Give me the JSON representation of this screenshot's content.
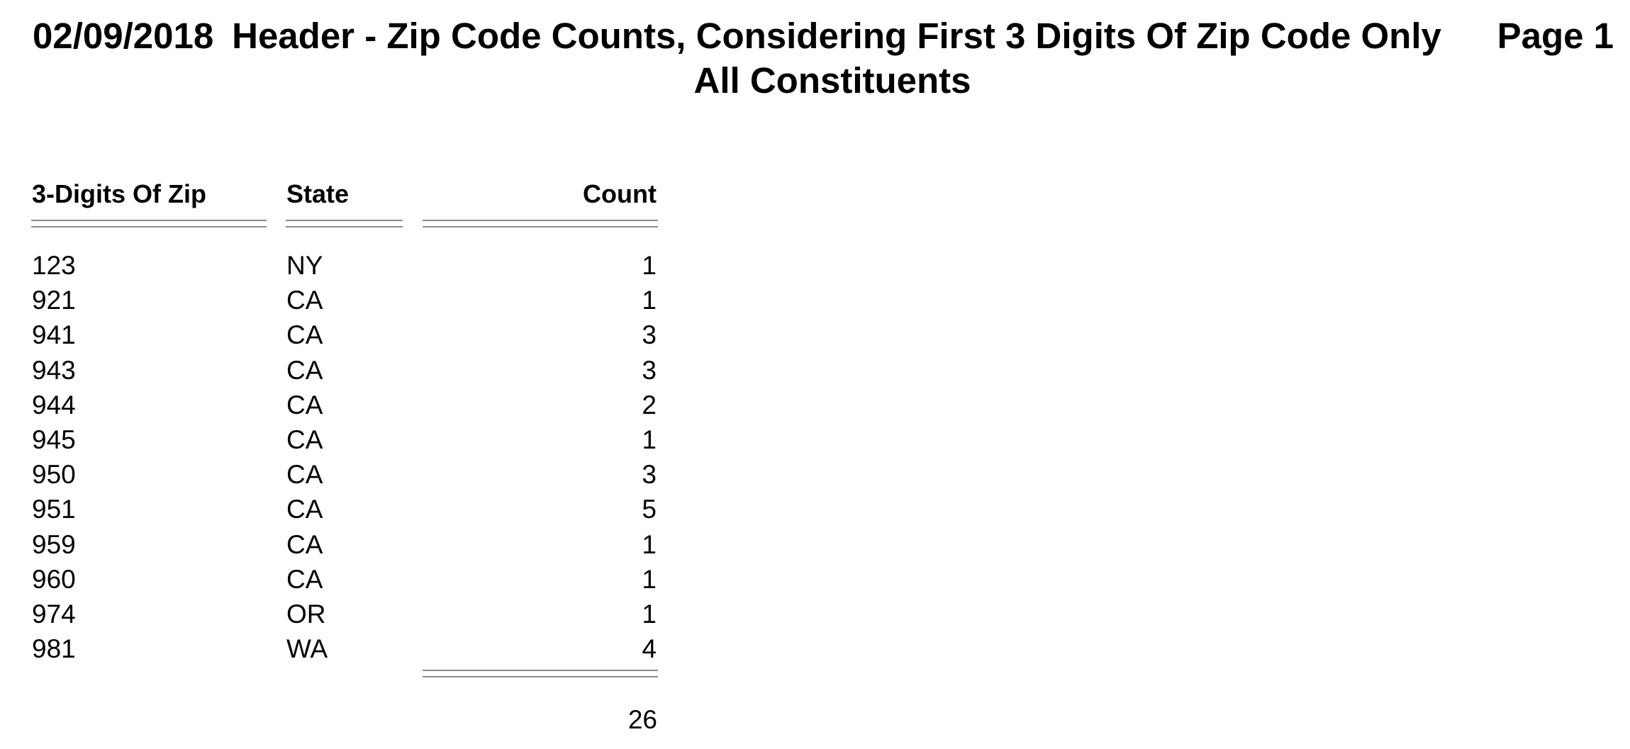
{
  "report": {
    "date": "02/09/2018",
    "title": "Header - Zip Code Counts, Considering First 3 Digits Of Zip Code Only",
    "page": "Page 1",
    "subtitle": "All Constituents"
  },
  "table": {
    "columns": [
      "3-Digits Of Zip",
      "State",
      "Count"
    ],
    "rows": [
      {
        "zip": "123",
        "state": "NY",
        "count": "1"
      },
      {
        "zip": "921",
        "state": "CA",
        "count": "1"
      },
      {
        "zip": "941",
        "state": "CA",
        "count": "3"
      },
      {
        "zip": "943",
        "state": "CA",
        "count": "3"
      },
      {
        "zip": "944",
        "state": "CA",
        "count": "2"
      },
      {
        "zip": "945",
        "state": "CA",
        "count": "1"
      },
      {
        "zip": "950",
        "state": "CA",
        "count": "3"
      },
      {
        "zip": "951",
        "state": "CA",
        "count": "5"
      },
      {
        "zip": "959",
        "state": "CA",
        "count": "1"
      },
      {
        "zip": "960",
        "state": "CA",
        "count": "1"
      },
      {
        "zip": "974",
        "state": "OR",
        "count": "1"
      },
      {
        "zip": "981",
        "state": "WA",
        "count": "4"
      }
    ],
    "total": "26"
  },
  "colors": {
    "text": "#000000",
    "rule": "#8a8a8a",
    "background": "#ffffff"
  }
}
